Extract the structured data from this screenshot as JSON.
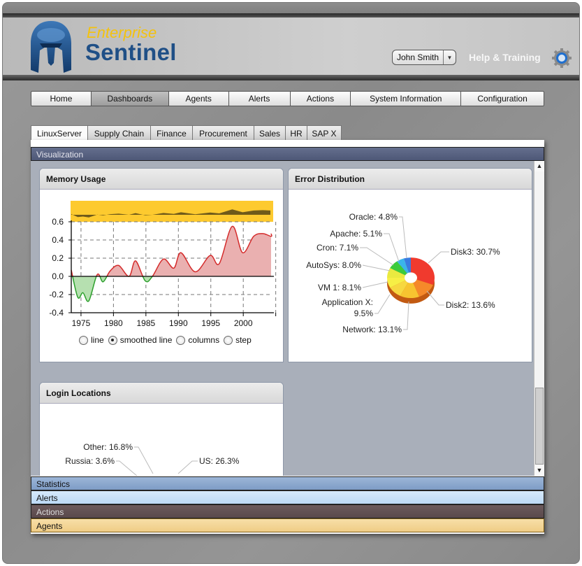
{
  "app": {
    "logo_line1": "Enterprise",
    "logo_line2": "Sentinel",
    "user_name": "John Smith",
    "help_link": "Help & Training"
  },
  "nav": {
    "items": [
      {
        "label": "Home",
        "active": false
      },
      {
        "label": "Dashboards",
        "active": true
      },
      {
        "label": "Agents",
        "active": false
      },
      {
        "label": "Alerts",
        "active": false
      },
      {
        "label": "Actions",
        "active": false
      },
      {
        "label": "System Information",
        "active": false
      },
      {
        "label": "Configuration",
        "active": false
      }
    ]
  },
  "tabs": {
    "items": [
      {
        "label": "LinuxServer",
        "active": true
      },
      {
        "label": "Supply Chain",
        "active": false
      },
      {
        "label": "Finance",
        "active": false
      },
      {
        "label": "Procurement",
        "active": false
      },
      {
        "label": "Sales",
        "active": false
      },
      {
        "label": "HR",
        "active": false
      },
      {
        "label": "SAP X",
        "active": false
      }
    ]
  },
  "sections": {
    "visualization": "Visualization",
    "statistics": "Statistics",
    "alerts": "Alerts",
    "actions": "Actions",
    "agents": "Agents"
  },
  "cards": {
    "memory": {
      "title": "Memory Usage",
      "chart_type_options": [
        {
          "label": "line",
          "selected": false
        },
        {
          "label": "smoothed line",
          "selected": true
        },
        {
          "label": "columns",
          "selected": false
        },
        {
          "label": "step",
          "selected": false
        }
      ]
    },
    "errors": {
      "title": "Error Distribution"
    },
    "logins": {
      "title": "Login Locations"
    }
  },
  "chart_data": [
    {
      "type": "area",
      "title": "Memory Usage",
      "xlabel": "",
      "ylabel": "",
      "x_ticks": [
        "1975",
        "1980",
        "1985",
        "1990",
        "1995",
        "2000"
      ],
      "y_ticks": [
        "0.6",
        "0.4",
        "0.2",
        "0.0",
        "-0.2",
        "-0.4"
      ],
      "ylim": [
        -0.4,
        0.6
      ],
      "xlim": [
        1973.5,
        2004.5
      ],
      "grid": true,
      "positive_color": "#d42b2b",
      "negative_color": "#2ca02c",
      "x": [
        1973.5,
        1974.5,
        1975.3,
        1976.2,
        1977.5,
        1978.4,
        1979.5,
        1980.8,
        1982.4,
        1983.4,
        1984.9,
        1986.0,
        1987.7,
        1989.3,
        1990.4,
        1992.6,
        1994.9,
        1996.3,
        1998.3,
        1999.9,
        2001.6,
        2003.0,
        2004.5,
        2005.3
      ],
      "values": [
        0.07,
        -0.23,
        -0.18,
        -0.27,
        0.02,
        -0.06,
        0.06,
        0.12,
        0.0,
        0.17,
        -0.05,
        0.0,
        0.19,
        0.09,
        0.26,
        0.05,
        0.23,
        0.14,
        0.55,
        0.26,
        0.44,
        0.47,
        0.44,
        0.47
      ]
    },
    {
      "type": "pie",
      "title": "Error Distribution",
      "labels": [
        "Disk3",
        "Disk2",
        "Network",
        "Application X",
        "VM 1",
        "AutoSys",
        "Cron",
        "Apache",
        "Oracle"
      ],
      "values": [
        30.7,
        13.6,
        13.1,
        9.5,
        8.1,
        8.0,
        7.1,
        5.1,
        4.8
      ],
      "display_labels": [
        "Disk3: 30.7%",
        "Disk2: 13.6%",
        "Network: 13.1%",
        "Application X:",
        "9.5%",
        "VM 1: 8.1%",
        "AutoSys: 8.0%",
        "Cron: 7.1%",
        "Apache: 5.1%",
        "Oracle: 4.8%"
      ],
      "colors": [
        "#f03a2e",
        "#f5892a",
        "#f7c430",
        "#f7d840",
        "#f7ef45",
        "#eaea40",
        "#3ccb3c",
        "#3ab5ea",
        "#3a7be0"
      ]
    },
    {
      "type": "pie",
      "title": "Login Locations",
      "labels": [
        "US",
        "Other",
        "Russia"
      ],
      "values": [
        26.3,
        16.8,
        3.6
      ],
      "display_labels": [
        "US: 26.3%",
        "Other: 16.8%",
        "Russia: 3.6%"
      ],
      "colors": [
        "#f03a2e",
        "#c84bf0",
        "#6a55e0"
      ]
    }
  ]
}
